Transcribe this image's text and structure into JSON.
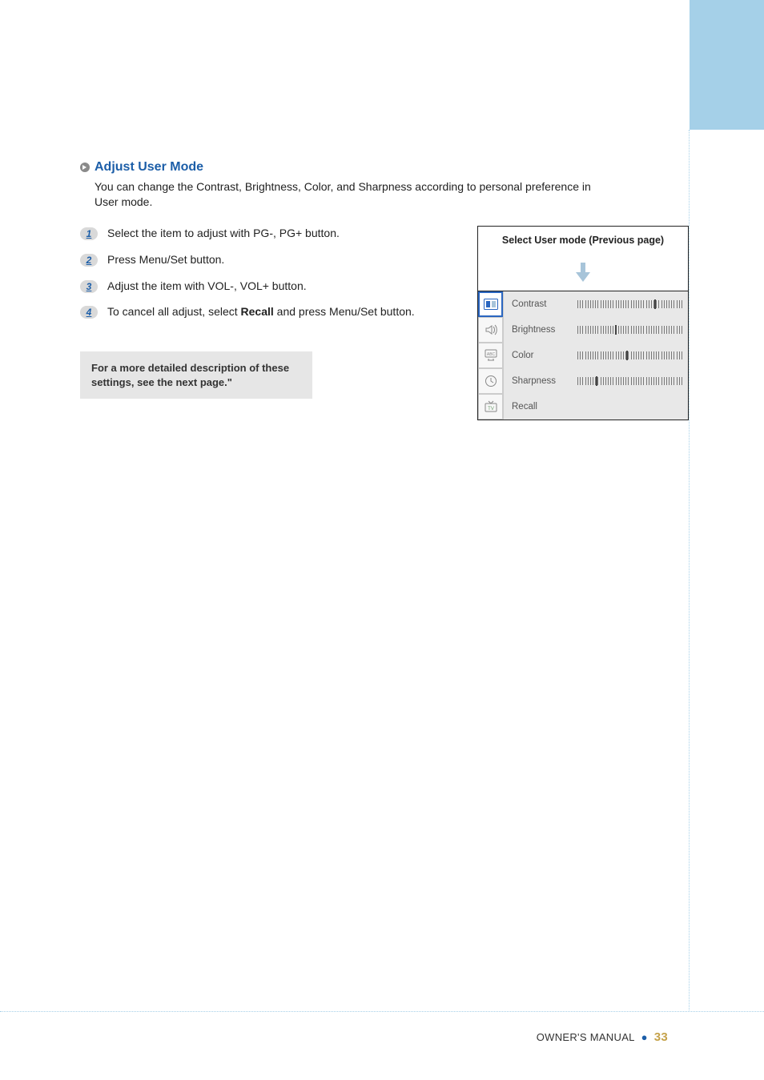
{
  "section": {
    "title": "Adjust User Mode",
    "description": "You can change the Contrast, Brightness, Color, and Sharpness according to personal preference in User mode."
  },
  "steps": [
    {
      "n": "1",
      "text": "Select the item to adjust with PG-, PG+ button."
    },
    {
      "n": "2",
      "text": "Press Menu/Set button."
    },
    {
      "n": "3",
      "text": "Adjust the item with VOL-, VOL+ button."
    },
    {
      "n": "4",
      "prefix": "To cancel all adjust, select ",
      "bold": "Recall",
      "suffix": " and press Menu/Set button."
    }
  ],
  "note": "For a more detailed description of these settings, see the next page.\"",
  "osd": {
    "caption": "Select User mode (Previous page)",
    "rows": [
      {
        "label": "Contrast",
        "value": 74
      },
      {
        "label": "Brightness",
        "value": 36
      },
      {
        "label": "Color",
        "value": 47
      },
      {
        "label": "Sharpness",
        "value": 18
      },
      {
        "label": "Recall",
        "value": null
      }
    ],
    "icons": [
      "picture",
      "sound",
      "features",
      "time",
      "tv"
    ]
  },
  "footer": {
    "label": "OWNER'S MANUAL",
    "page": "33"
  }
}
